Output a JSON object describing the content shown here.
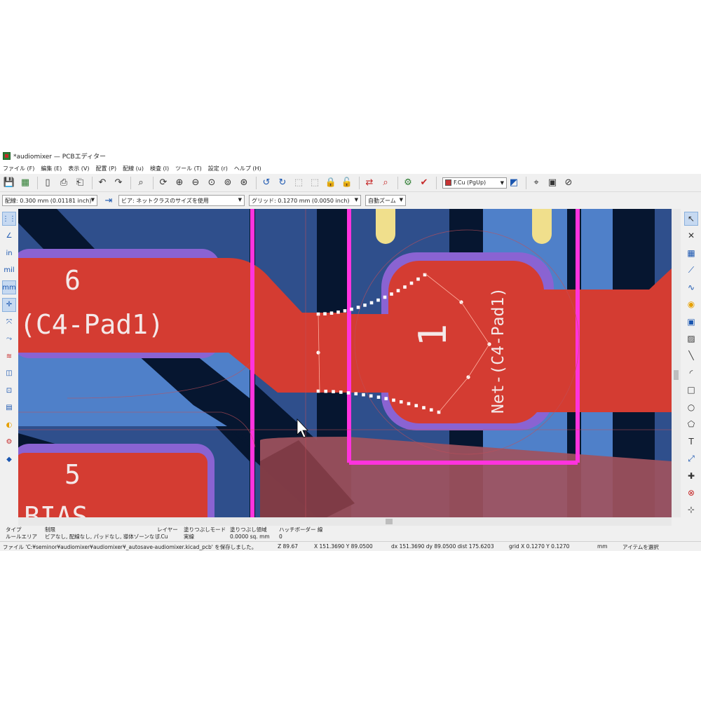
{
  "window": {
    "title": "*audiomixer — PCBエディター"
  },
  "menu": [
    "ファイル (F)",
    "編集 (E)",
    "表示 (V)",
    "配置 (P)",
    "配線 (u)",
    "検査 (I)",
    "ツール (T)",
    "設定 (r)",
    "ヘルプ (H)"
  ],
  "toolbar": {
    "icons": [
      "save-icon",
      "board-setup-icon",
      "page-settings-icon",
      "print-icon",
      "plot-icon",
      "undo-icon",
      "redo-icon",
      "find-icon",
      "refresh-icon",
      "zoom-in-icon",
      "zoom-out-icon",
      "zoom-fit-icon",
      "zoom-objects-icon",
      "zoom-selection-icon",
      "rotate-ccw-icon",
      "rotate-cw-icon",
      "group-icon",
      "ungroup-icon",
      "lock-icon",
      "unlock-icon",
      "update-pcb-icon",
      "inspect-icon",
      "scripting-icon",
      "drc-icon"
    ],
    "layer": "F.Cu (PgUp)"
  },
  "options": {
    "track": "配線: 0.300 mm (0.01181 inch)",
    "via": "ビア: ネットクラスのサイズを使用",
    "grid": "グリッド: 0.1270 mm (0.0050 inch)",
    "zoom": "自動ズーム"
  },
  "left_toolbar": {
    "items": [
      {
        "name": "grid-toggle-icon",
        "glyph": "⋮⋮"
      },
      {
        "name": "polar-coords-icon",
        "glyph": "∠"
      },
      {
        "name": "units-inch-icon",
        "glyph": "in"
      },
      {
        "name": "units-mil-icon",
        "glyph": "mil"
      },
      {
        "name": "units-mm-icon",
        "glyph": "mm"
      },
      {
        "name": "cursor-shape-icon",
        "glyph": "✛"
      },
      {
        "name": "ratsnest-icon",
        "glyph": "⤧"
      },
      {
        "name": "curved-ratsnest-icon",
        "glyph": "⤳"
      },
      {
        "name": "zone-display-icon",
        "glyph": "≋"
      },
      {
        "name": "pad-display-icon",
        "glyph": "◫"
      },
      {
        "name": "via-display-icon",
        "glyph": "⊡"
      },
      {
        "name": "track-display-icon",
        "glyph": "▤"
      },
      {
        "name": "high-contrast-icon",
        "glyph": "◐"
      },
      {
        "name": "net-inspector-icon",
        "glyph": "⚙"
      },
      {
        "name": "layers-manager-icon",
        "glyph": "◆"
      }
    ]
  },
  "right_toolbar": {
    "items": [
      {
        "name": "select-icon",
        "glyph": "↖"
      },
      {
        "name": "local-ratsnest-icon",
        "glyph": "✕"
      },
      {
        "name": "add-footprint-icon",
        "glyph": "▦"
      },
      {
        "name": "route-track-icon",
        "glyph": "⟋"
      },
      {
        "name": "tune-length-icon",
        "glyph": "∿"
      },
      {
        "name": "add-via-icon",
        "glyph": "◉"
      },
      {
        "name": "add-zone-icon",
        "glyph": "▣"
      },
      {
        "name": "rule-area-icon",
        "glyph": "▨"
      },
      {
        "name": "draw-line-icon",
        "glyph": "╲"
      },
      {
        "name": "draw-arc-icon",
        "glyph": "◜"
      },
      {
        "name": "draw-rectangle-icon",
        "glyph": "□"
      },
      {
        "name": "draw-circle-icon",
        "glyph": "○"
      },
      {
        "name": "draw-polygon-icon",
        "glyph": "⬠"
      },
      {
        "name": "add-text-icon",
        "glyph": "T"
      },
      {
        "name": "add-dimension-icon",
        "glyph": "⤢"
      },
      {
        "name": "set-origin-icon",
        "glyph": "✚"
      },
      {
        "name": "delete-tool-icon",
        "glyph": "⊗"
      },
      {
        "name": "grid-origin-icon",
        "glyph": "⊹"
      }
    ]
  },
  "board": {
    "pad_labels": [
      {
        "number": "6",
        "net": "(C4-Pad1)"
      },
      {
        "number": "5",
        "net": "BIAS"
      }
    ],
    "pad_center_number": "1",
    "pad_center_net": "Net-(C4-Pad1)",
    "colors": {
      "background": "#061630",
      "zone_blue": "#2f4f8c",
      "zone_blue_light": "#4f80c9",
      "copper": "#d43c32",
      "outline": "#ff33dd",
      "selected_zone": "#a0525e",
      "pad_yellow": "#f0df8c",
      "clearance": "#8a63d2"
    }
  },
  "messages": {
    "headers": [
      "タイプ",
      "制限",
      "レイヤー",
      "塗りつぶしモード",
      "塗りつぶし領域",
      "ハッチボーダー 線"
    ],
    "values": [
      "ルールエリア",
      "ビアなし, 配線なし, パッドなし, 導体ゾーンなし",
      "F.Cu",
      "実線",
      "0.0000 sq. mm",
      "0"
    ]
  },
  "status": {
    "file": "ファイル 'C:¥seminor¥audiomixer¥audiomixer¥_autosave-audiomixer.kicad_pcb' を保存しました。",
    "zoom": "Z 89.67",
    "xy": "X 151.3690  Y 89.0500",
    "delta": "dx 151.3690  dy 89.0500  dist 175.6203",
    "grid": "grid X 0.1270  Y 0.1270",
    "units": "mm",
    "mode": "アイテムを選択"
  }
}
